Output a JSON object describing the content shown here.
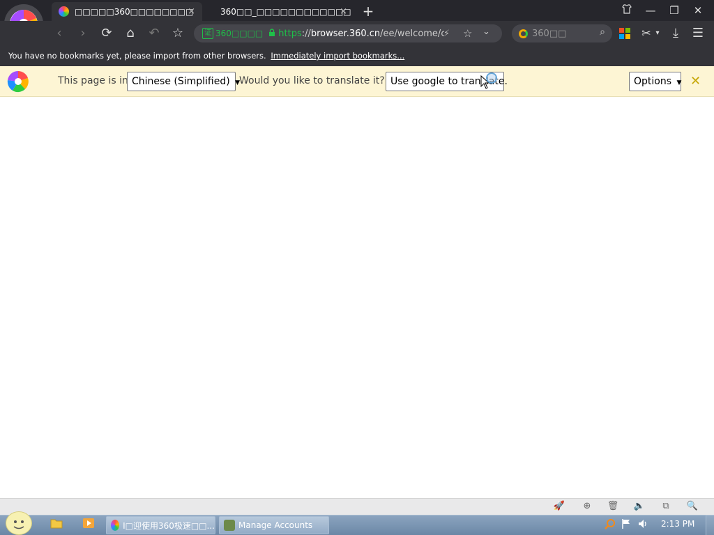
{
  "browser": {
    "tabs": [
      {
        "title": "□□□□□360□□□□□□□□",
        "active": true,
        "close": "×"
      },
      {
        "title": "360□□_□□□□□□□□□□□□",
        "active": false,
        "close": "×"
      }
    ],
    "new_tab": "+",
    "window_controls": {
      "skin": "👕",
      "minimize": "—",
      "restore": "❐",
      "close": "✕"
    },
    "toolbar": {
      "back": "‹",
      "forward": "›",
      "reload": "⟳",
      "home": "⌂",
      "undo": "↶",
      "favorite": "☆"
    },
    "address": {
      "cert_badge": "证",
      "cert_label": "360□□□□",
      "scheme": "https",
      "rest_scheme": "://",
      "host": "browser.360.cn",
      "path": "/ee/welcome/chr",
      "lightning": "⚡",
      "star": "☆",
      "dropdown": "⌄"
    },
    "search": {
      "placeholder": "360□□",
      "icon": "⌕"
    },
    "right_icons": {
      "apps": "apps-grid-icon",
      "scissors": "✂",
      "scissors_arrow": "▾",
      "download": "⤓",
      "menu": "☰"
    },
    "bookmark_bar": {
      "message": "You have no bookmarks yet, please import from other browsers.",
      "link": "Immediately import bookmarks..."
    }
  },
  "translate_bar": {
    "prefix": "This page is in",
    "language": "Chinese (Simplified)",
    "question": "Would you like to translate it?",
    "translate_button": "Use google to translate.",
    "options": "Options",
    "close": "✕"
  },
  "status_bar_icons": [
    "🚀",
    "⊕",
    "🗑",
    "🔈",
    "⧉",
    "🔍"
  ],
  "taskbar": {
    "tasks": [
      {
        "label": "I□迎使用360极速□□..."
      },
      {
        "label": "Manage Accounts"
      }
    ],
    "clock": "2:13 PM"
  },
  "colors": {
    "tab_bg": "#26262c",
    "toolbar_bg": "#333338",
    "secure_green": "#1fbf49",
    "translate_bar_bg": "#fdf5d4",
    "taskbar_bg": "#6b87a6"
  }
}
